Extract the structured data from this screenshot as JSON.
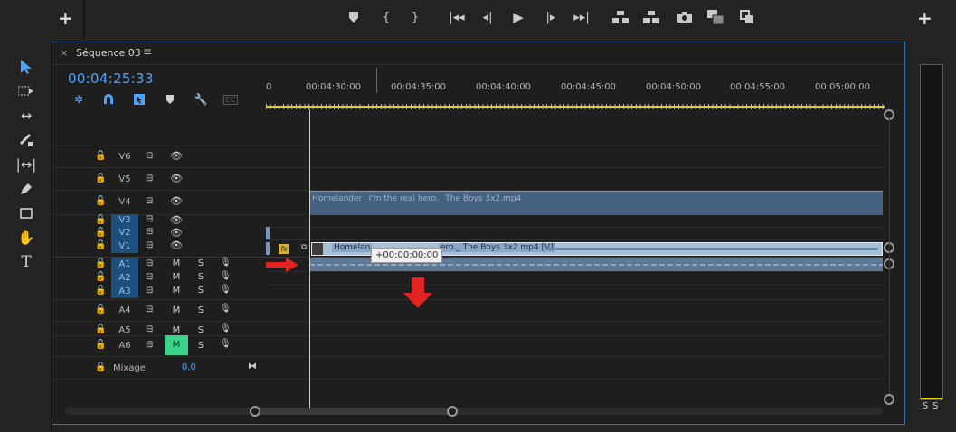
{
  "sequence": {
    "title": "Séquence 03",
    "timecode": "00:04:25:33"
  },
  "ruler": {
    "labels": [
      "0",
      "00:04:30:00",
      "00:04:35:00",
      "00:04:40:00",
      "00:04:45:00",
      "00:04:50:00",
      "00:04:55:00",
      "00:05:00:00"
    ]
  },
  "tracks": {
    "video": [
      "V6",
      "V5",
      "V4",
      "V3",
      "V2",
      "V1"
    ],
    "audio": [
      "A1",
      "A2",
      "A3",
      "A4",
      "A5",
      "A6"
    ],
    "mute_label": "M",
    "solo_label": "S",
    "mix_label": "Mixage",
    "mix_value": "0,0"
  },
  "clips": {
    "v4_name": "Homelander _I'm the real hero._ The Boys 3x2.mp4",
    "v1_name_left": "Homelan",
    "v1_name_right": "ero._ The Boys 3x2.mp4 [V]",
    "fx_label": "fx"
  },
  "tooltip": "+00:00:00:00",
  "meter": {
    "solo_left": "S",
    "solo_right": "S"
  },
  "colors": {
    "accent": "#4aa3ff",
    "target_track": "#1d4f7c",
    "mute_active": "#3bd28b",
    "work_area": "#e8d200",
    "arrow": "#e32222"
  }
}
